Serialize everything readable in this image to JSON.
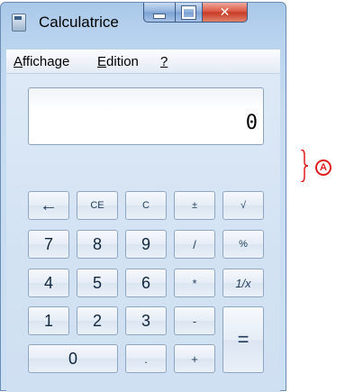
{
  "window": {
    "title": "Calculatrice"
  },
  "menu": {
    "items": [
      {
        "first": "A",
        "rest": "ffichage"
      },
      {
        "first": "E",
        "rest": "dition"
      },
      {
        "first": "?",
        "rest": ""
      }
    ]
  },
  "display": {
    "value": "0"
  },
  "keys": {
    "row1": [
      "←",
      "CE",
      "C",
      "±",
      "√"
    ],
    "row2": [
      "7",
      "8",
      "9",
      "/",
      "%"
    ],
    "row3": [
      "4",
      "5",
      "6",
      "*",
      "1/x"
    ],
    "row4": [
      "1",
      "2",
      "3",
      "-"
    ],
    "row5": [
      "0",
      ".",
      "+"
    ],
    "equals": "="
  },
  "annotation": {
    "label": "A",
    "color": "#e21c1c"
  }
}
